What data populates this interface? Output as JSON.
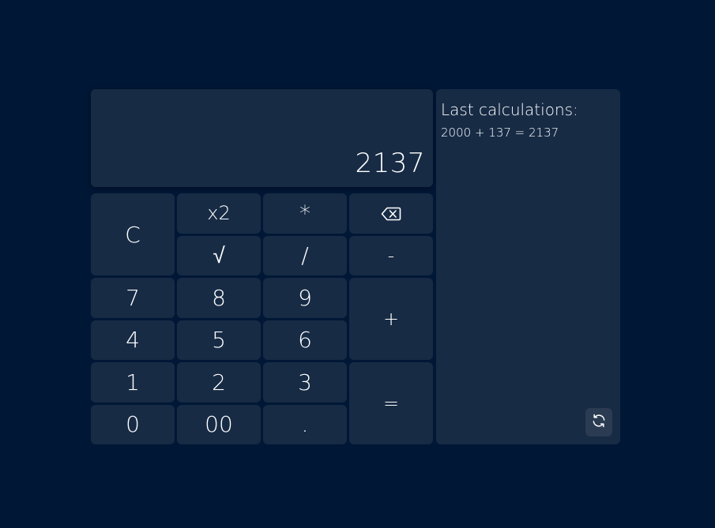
{
  "display": {
    "value": "2137"
  },
  "keys": {
    "clear": "C",
    "square": "x2",
    "multiply": "*",
    "backspace_icon": "backspace-icon",
    "sqrt": "√",
    "divide": "/",
    "minus": "-",
    "seven": "7",
    "eight": "8",
    "nine": "9",
    "plus": "+",
    "four": "4",
    "five": "5",
    "six": "6",
    "one": "1",
    "two": "2",
    "three": "3",
    "equals": "=",
    "zero": "0",
    "double_zero": "00",
    "decimal": "."
  },
  "history": {
    "title": "Last calculations:",
    "entries": [
      "2000 + 137 = 2137"
    ],
    "refresh_icon": "refresh-icon"
  },
  "colors": {
    "background": "#001736",
    "panel": "#172b45",
    "text": "#ffffff"
  }
}
